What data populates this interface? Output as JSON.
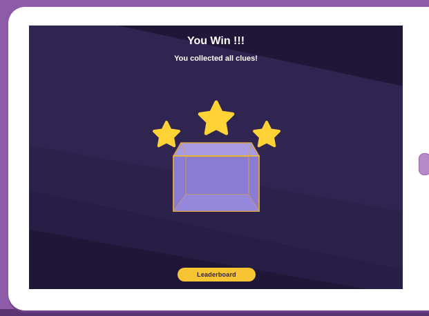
{
  "screen": {
    "title": "You Win !!!",
    "subtitle": "You collected all clues!"
  },
  "actions": {
    "leaderboard_label": "Leaderboard"
  },
  "colors": {
    "background": "#8e5ba8",
    "screen": "#1f1638",
    "star": "#ffd236",
    "box": "#8a7bd4",
    "box_edge": "#d6a23e",
    "button": "#f7c533"
  }
}
